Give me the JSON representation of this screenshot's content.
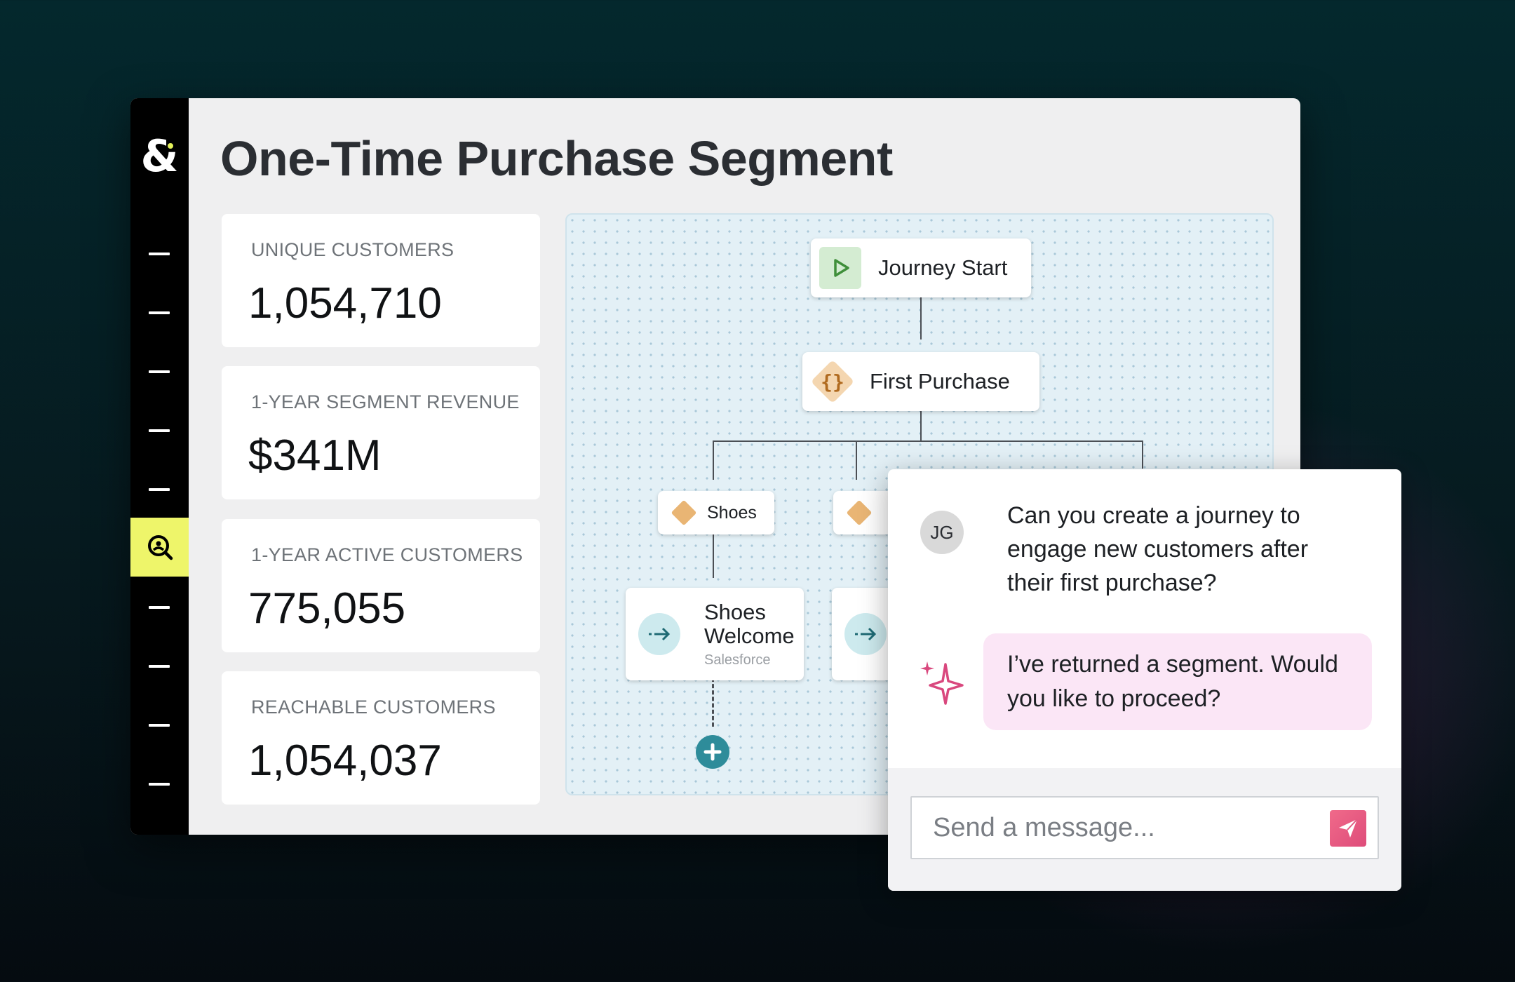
{
  "app": {
    "logo": "&",
    "page_title": "One-Time Purchase Segment"
  },
  "sidebar": {
    "active_item_icon": "search-person-icon",
    "items": [
      "nav-1",
      "nav-2",
      "nav-3",
      "nav-4",
      "nav-5",
      "segments",
      "nav-7",
      "nav-8",
      "nav-9",
      "nav-10"
    ]
  },
  "stats": [
    {
      "label": "UNIQUE CUSTOMERS",
      "value": "1,054,710"
    },
    {
      "label": "1-YEAR SEGMENT REVENUE",
      "value": "$341M"
    },
    {
      "label": "1-YEAR ACTIVE CUSTOMERS",
      "value": "775,055"
    },
    {
      "label": "REACHABLE CUSTOMERS",
      "value": "1,054,037"
    }
  ],
  "flow": {
    "start": {
      "label": "Journey Start",
      "icon": "play-icon"
    },
    "condition": {
      "label": "First Purchase",
      "icon": "braces-icon"
    },
    "branches": [
      {
        "label": "Shoes",
        "action": {
          "title": "Shoes Welcome",
          "subtitle": "Salesforce"
        }
      }
    ],
    "add_step_icon": "plus-circle-icon"
  },
  "chat": {
    "user_initials": "JG",
    "user_message": "Can you create a journey to engage new customers after their first purchase?",
    "assistant_message": "I’ve returned a segment. Would you like to proceed?",
    "input_placeholder": "Send a message...",
    "send_icon": "paper-plane-icon"
  },
  "colors": {
    "sidebar_active": "#eef56a",
    "accent_pink": "#de4c7a",
    "node_diamond": "#e9b574",
    "start_icon_bg": "#d4ecd2",
    "action_icon_bg": "#cdeaee",
    "add_step": "#2e8c9a"
  }
}
